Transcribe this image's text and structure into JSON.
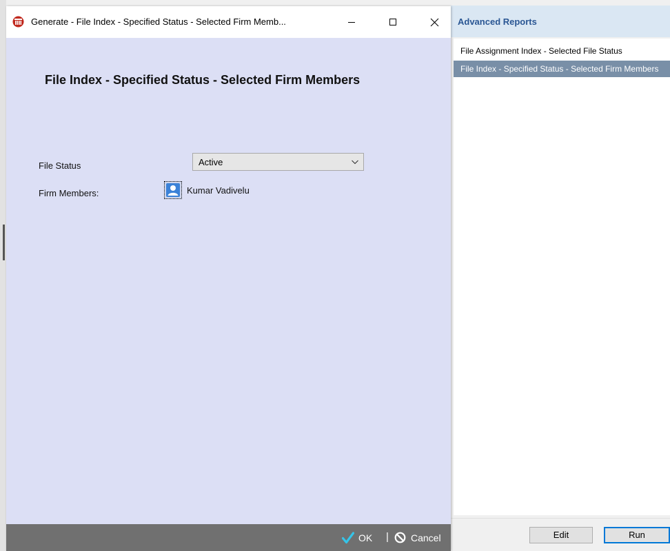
{
  "dialog": {
    "title": "Generate - File Index - Specified Status - Selected Firm Memb...",
    "heading": "File Index - Specified Status - Selected Firm Members",
    "window_controls": {
      "minimize_icon": "minimize-icon",
      "maximize_icon": "maximize-icon",
      "close_icon": "close-icon"
    },
    "file_status": {
      "label": "File Status",
      "value": "Active"
    },
    "firm_members": {
      "label": "Firm Members:",
      "member_name": "Kumar Vadivelu",
      "icon": "user-icon"
    },
    "footer": {
      "ok_label": "OK",
      "separator": "|",
      "cancel_label": "Cancel"
    }
  },
  "reports_panel": {
    "title": "Advanced Reports",
    "items": [
      {
        "label": "File Assignment Index - Selected File Status"
      },
      {
        "label": "File Index - Specified Status - Selected Firm Members"
      }
    ],
    "edit_label": "Edit",
    "run_label": "Run"
  },
  "colors": {
    "dialog_background": "#dcdff5",
    "footer_background": "#707070",
    "ok_check": "#35c4e8",
    "panel_title": "#2a5693",
    "selected_item": "#798fa7",
    "run_border": "#0078d7"
  }
}
